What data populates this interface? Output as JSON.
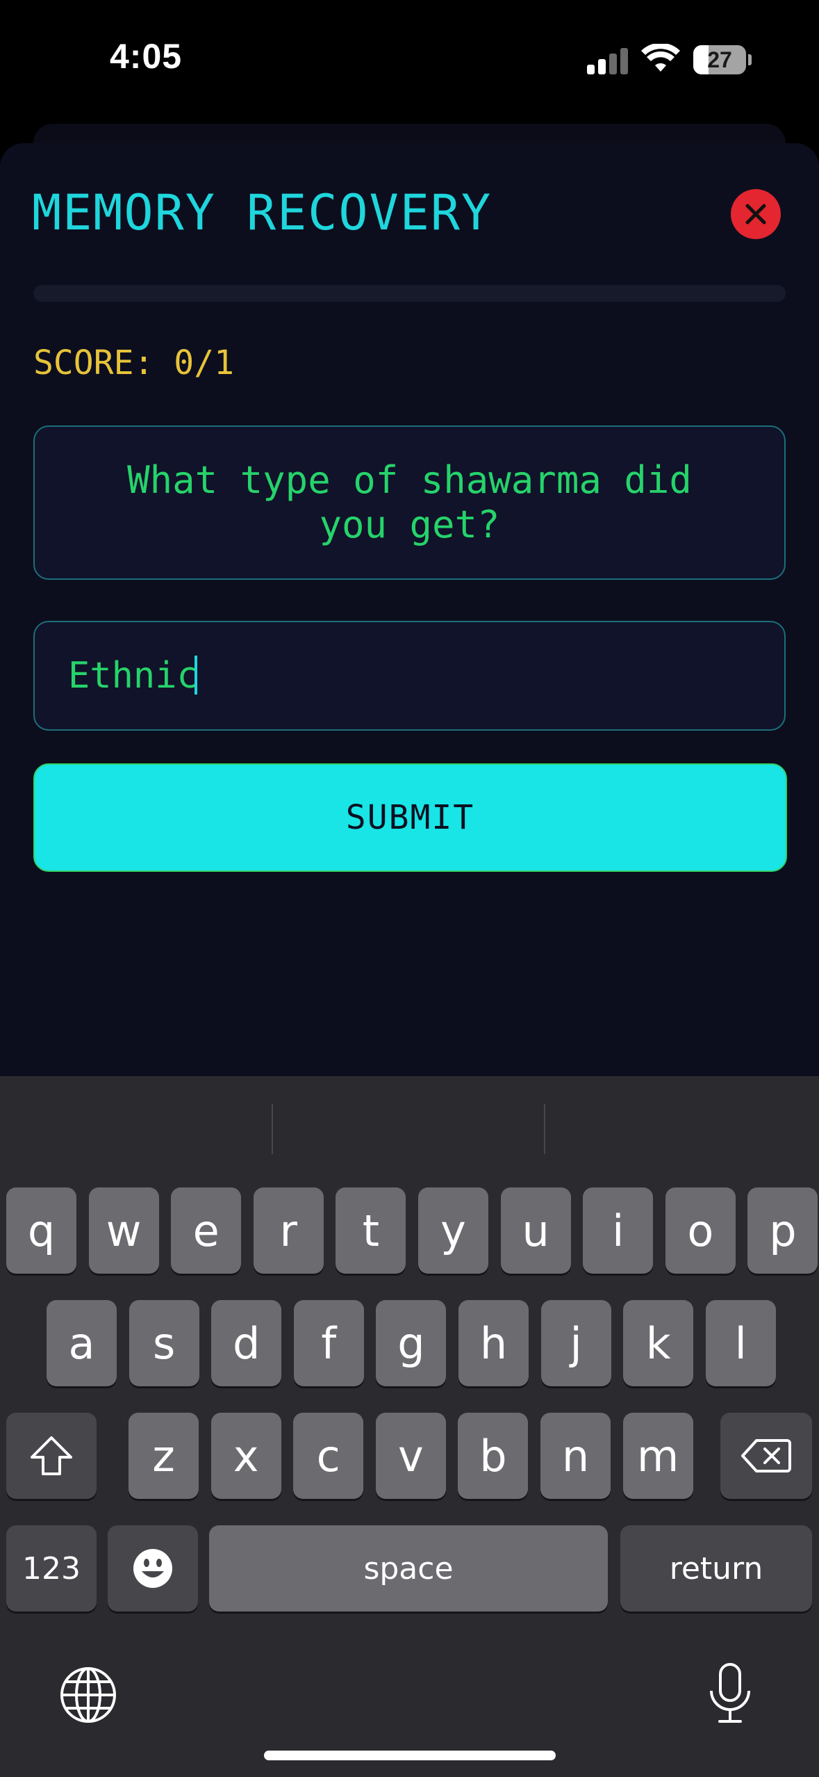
{
  "status_bar": {
    "time": "4:05",
    "battery_level": "27",
    "icons": [
      "cellular-signal-icon",
      "wifi-icon",
      "battery-icon"
    ]
  },
  "game": {
    "title": "MEMORY RECOVERY",
    "close_icon": "close-icon",
    "progress_fraction": 0,
    "score": "SCORE: 0/1",
    "question": "What type of shawarma did you get?",
    "answer_value": "Ethnic",
    "submit_label": "SUBMIT"
  },
  "colors": {
    "accent": "#1fd6dc",
    "text_green": "#26d36a",
    "score_yellow": "#e6c33a",
    "close_red": "#e3262f",
    "background": "#0c0e1e"
  },
  "keyboard": {
    "row1": [
      "q",
      "w",
      "e",
      "r",
      "t",
      "y",
      "u",
      "i",
      "o",
      "p"
    ],
    "row2": [
      "a",
      "s",
      "d",
      "f",
      "g",
      "h",
      "j",
      "k",
      "l"
    ],
    "row3": [
      "z",
      "x",
      "c",
      "v",
      "b",
      "n",
      "m"
    ],
    "numbers_label": "123",
    "space_label": "space",
    "return_label": "return",
    "icons": [
      "shift-icon",
      "backspace-icon",
      "emoji-icon",
      "globe-icon",
      "microphone-icon"
    ]
  }
}
